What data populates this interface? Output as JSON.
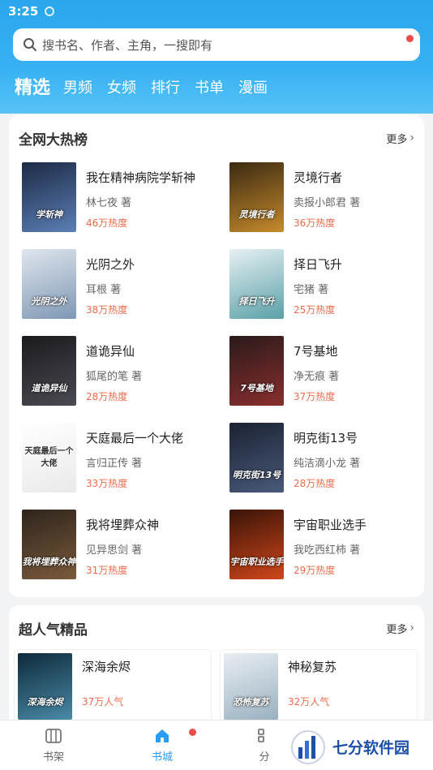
{
  "status": {
    "time": "3:25"
  },
  "search": {
    "placeholder": "搜书名、作者、主角，一搜即有"
  },
  "tabs": [
    "精选",
    "男频",
    "女频",
    "排行",
    "书单",
    "漫画"
  ],
  "hot": {
    "title": "全网大热榜",
    "more": "更多",
    "books": [
      {
        "title": "我在精神病院学斩神",
        "author": "林七夜 著",
        "heat": "46万热度",
        "cover_text": "学斩神",
        "c1": "#1d2a44",
        "c2": "#5b7fb6"
      },
      {
        "title": "灵境行者",
        "author": "卖报小郎君 著",
        "heat": "36万热度",
        "cover_text": "灵境行者",
        "c1": "#3a2a12",
        "c2": "#c78a2c"
      },
      {
        "title": "光阴之外",
        "author": "耳根 著",
        "heat": "38万热度",
        "cover_text": "光阴之外",
        "c1": "#dfe6ee",
        "c2": "#7f97b4"
      },
      {
        "title": "择日飞升",
        "author": "宅猪 著",
        "heat": "25万热度",
        "cover_text": "择日飞升",
        "c1": "#e6f0f2",
        "c2": "#5aa0a8"
      },
      {
        "title": "道诡异仙",
        "author": "狐尾的笔 著",
        "heat": "28万热度",
        "cover_text": "道诡异仙",
        "c1": "#1a1a1e",
        "c2": "#4a4a52"
      },
      {
        "title": "7号基地",
        "author": "净无痕 著",
        "heat": "37万热度",
        "cover_text": "7号基地",
        "c1": "#2a1a1a",
        "c2": "#8a2e2e"
      },
      {
        "title": "天庭最后一个大佬",
        "author": "言归正传 著",
        "heat": "33万热度",
        "cover_text": "天庭最后一个大佬",
        "c1": "#ffffff",
        "c2": "#e9e9e9"
      },
      {
        "title": "明克街13号",
        "author": "纯洁滴小龙 著",
        "heat": "28万热度",
        "cover_text": "明克街13号",
        "c1": "#1b2233",
        "c2": "#4a5a7a"
      },
      {
        "title": "我将埋葬众神",
        "author": "见异思剑 著",
        "heat": "31万热度",
        "cover_text": "我将埋葬众神",
        "c1": "#2e241c",
        "c2": "#7a5a3c"
      },
      {
        "title": "宇宙职业选手",
        "author": "我吃西红柿 著",
        "heat": "29万热度",
        "cover_text": "宇宙职业选手",
        "c1": "#3a1408",
        "c2": "#d0461a"
      }
    ]
  },
  "popular": {
    "title": "超人气精品",
    "more": "更多",
    "books": [
      {
        "title": "深海余烬",
        "pop": "37万人气",
        "cover_text": "深海余烬",
        "c1": "#0e2a3a",
        "c2": "#4a8aa8"
      },
      {
        "title": "神秘复苏",
        "pop": "32万人气",
        "cover_text": "恐怖复苏",
        "c1": "#e8eef2",
        "c2": "#9ab0c0"
      }
    ]
  },
  "nav": {
    "shelf": "书架",
    "store": "书城",
    "category": "分"
  },
  "watermark": {
    "text": "七分软件园"
  },
  "colors": {
    "accent": "#2a9df0",
    "heat": "#ee6a4a",
    "badge": "#ef4b4b"
  }
}
